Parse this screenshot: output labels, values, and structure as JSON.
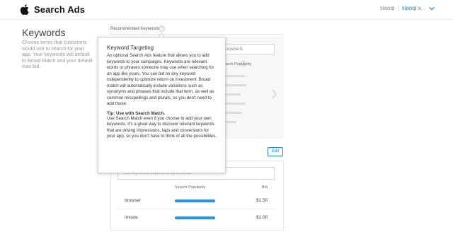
{
  "header": {
    "brand": "Search Ads",
    "org": "xiaoqi",
    "user": "xiaoqi x.",
    "icons": {
      "logo": "apple-logo-icon",
      "menu": "chevron-down-icon"
    },
    "accent_color": "#1a8ae6"
  },
  "left": {
    "title": "Keywords",
    "description": "Choose terms that customers would use to search for your app. Your keywords will default to Broad Match and your default max bid."
  },
  "recommended": {
    "label": "Recommended Keywords",
    "input_placeholder": "Keywords",
    "popularity_label": "Search Popularity"
  },
  "tooltip": {
    "title": "Keyword Targeting",
    "body": "An optional Search Ads feature that allows you to add keywords to your campaigns. Keywords are relevant words or phrases someone may use when searching for an app like yours. You can bid on any keyword independently to optimize return on investment. Broad match will automatically include variations such as synonyms and phrases that include that term, as well as common misspellings and plurals, so you don't need to add those.",
    "tip_heading": "Tip: Use with Search Match.",
    "tip_body": "Use Search Match even if you choose to add your own keywords. It's a great way to discover relevant keywords that are driving impressions, taps and conversions for your app, so you don't have to think of all the possibilities."
  },
  "keywords_card": {
    "edit_label": "Edit",
    "search_placeholder": "Add keywords separated by commas",
    "columns": {
      "popularity": "Search Popularity",
      "bid": "Bid"
    },
    "rows": [
      {
        "keyword": "browser",
        "bid": "$1.50",
        "popularity": 0.95
      },
      {
        "keyword": "imovie",
        "bid": "$1.00",
        "popularity": 0.95
      }
    ]
  }
}
